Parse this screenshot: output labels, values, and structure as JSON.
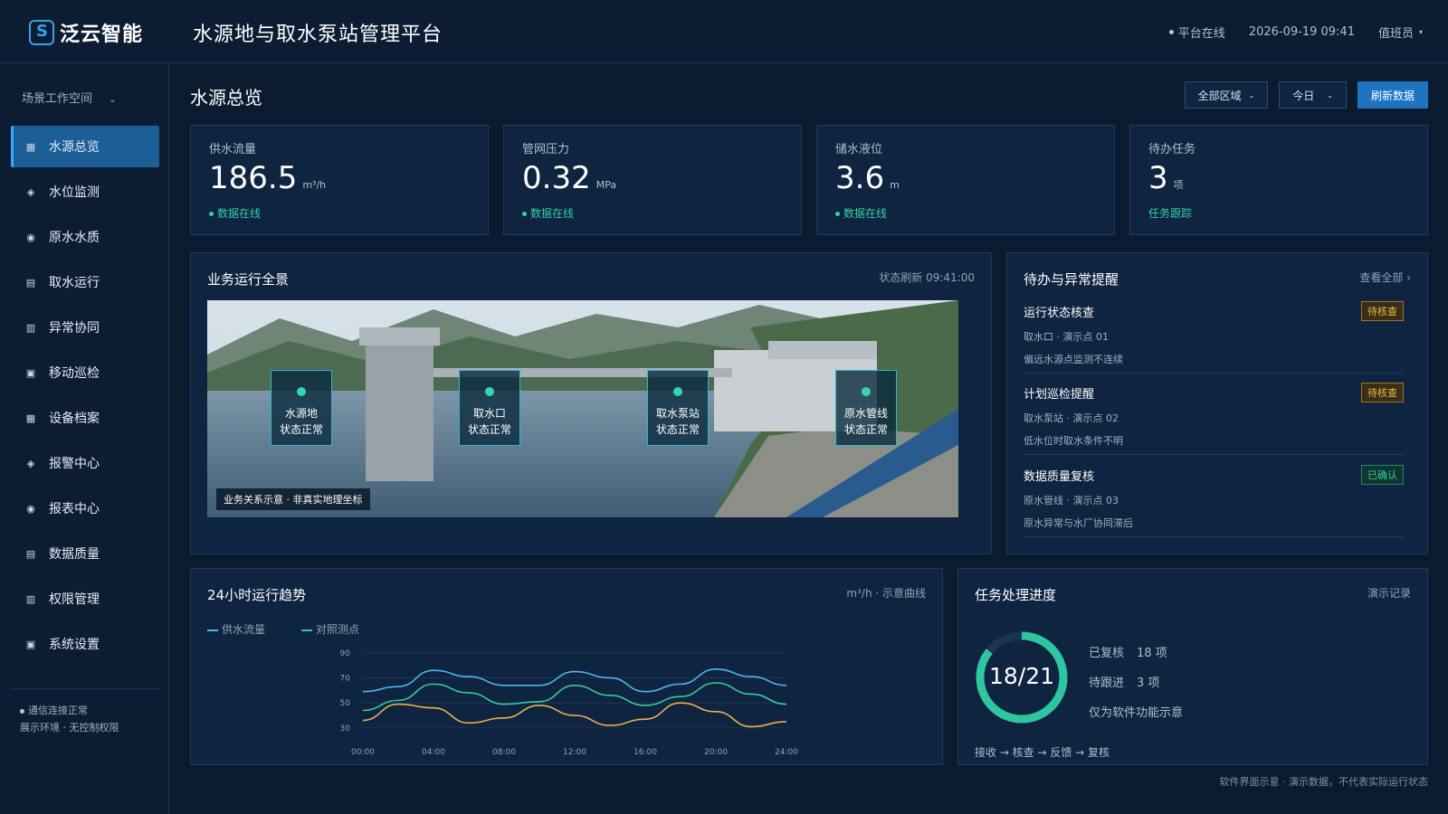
{
  "header": {
    "logo_text": "泛云智能",
    "app_title": "水源地与取水泵站管理平台",
    "status": "平台在线",
    "datetime": "2026-09-19 09:41",
    "user": "值班员"
  },
  "sidebar": {
    "workspace": "场景工作空间",
    "items": [
      {
        "label": "水源总览",
        "icon": "grid-icon",
        "active": true
      },
      {
        "label": "水位监测",
        "icon": "diamond-icon"
      },
      {
        "label": "原水水质",
        "icon": "circle-dot-icon"
      },
      {
        "label": "取水运行",
        "icon": "list-icon"
      },
      {
        "label": "异常协同",
        "icon": "columns-icon"
      },
      {
        "label": "移动巡检",
        "icon": "square-icon"
      },
      {
        "label": "设备档案",
        "icon": "grid-icon"
      },
      {
        "label": "报警中心",
        "icon": "diamond-icon"
      },
      {
        "label": "报表中心",
        "icon": "circle-dot-icon"
      },
      {
        "label": "数据质量",
        "icon": "list-icon"
      },
      {
        "label": "权限管理",
        "icon": "columns-icon"
      },
      {
        "label": "系统设置",
        "icon": "square-icon"
      }
    ],
    "footer_status": "通信连接正常",
    "footer_note": "展示环境 · 无控制权限"
  },
  "main": {
    "title": "水源总览",
    "filters": {
      "region": "全部区域",
      "period": "今日",
      "refresh": "刷新数据"
    }
  },
  "kpis": [
    {
      "label": "供水流量",
      "value": "186.5",
      "unit": "m³/h",
      "status": "数据在线",
      "status_dot": true
    },
    {
      "label": "管网压力",
      "value": "0.32",
      "unit": "MPa",
      "status": "数据在线",
      "status_dot": true
    },
    {
      "label": "储水液位",
      "value": "3.6",
      "unit": "m",
      "status": "数据在线",
      "status_dot": true
    },
    {
      "label": "待办任务",
      "value": "3",
      "unit": "项",
      "status": "任务跟踪",
      "status_dot": false
    }
  ],
  "overview": {
    "title": "业务运行全景",
    "refresh": "状态刷新 09:41:00",
    "nodes": [
      {
        "name": "水源地",
        "state": "状态正常"
      },
      {
        "name": "取水口",
        "state": "状态正常"
      },
      {
        "name": "取水泵站",
        "state": "状态正常"
      },
      {
        "name": "原水管线",
        "state": "状态正常"
      }
    ],
    "tag": "业务关系示意 · 非真实地理坐标"
  },
  "alerts": {
    "title": "待办与异常提醒",
    "view_all": "查看全部 ›",
    "items": [
      {
        "title": "运行状态核查",
        "location": "取水口 · 演示点 01",
        "desc": "偏远水源点监测不连续",
        "badge": "待核查",
        "badge_type": "pending"
      },
      {
        "title": "计划巡检提醒",
        "location": "取水泵站 · 演示点 02",
        "desc": "低水位时取水条件不明",
        "badge": "待核查",
        "badge_type": "pending"
      },
      {
        "title": "数据质量复核",
        "location": "原水管线 · 演示点 03",
        "desc": "原水异常与水厂协同滞后",
        "badge": "已确认",
        "badge_type": "done"
      }
    ]
  },
  "trend": {
    "title": "24小时运行趋势",
    "meta": "m³/h · 示意曲线",
    "legend": [
      "供水流量",
      "对照测点"
    ]
  },
  "chart_data": {
    "type": "line",
    "x": [
      "00:00",
      "02:00",
      "04:00",
      "06:00",
      "08:00",
      "10:00",
      "12:00",
      "14:00",
      "16:00",
      "18:00",
      "20:00",
      "22:00",
      "24:00"
    ],
    "xticks": [
      "00:00",
      "04:00",
      "08:00",
      "12:00",
      "16:00",
      "20:00",
      "24:00"
    ],
    "yticks": [
      90,
      70,
      50,
      30
    ],
    "ylim": [
      27,
      92
    ],
    "series": [
      {
        "name": "供水流量",
        "color": "#4fb6ee",
        "values": [
          59,
          63,
          76,
          71,
          64,
          64,
          75,
          70,
          59,
          65,
          77,
          71,
          64
        ]
      },
      {
        "name": "对照测点",
        "color": "#35c9a0",
        "values": [
          44,
          52,
          65,
          58,
          49,
          51,
          64,
          56,
          48,
          55,
          66,
          57,
          49
        ]
      },
      {
        "color": "#e6b44c",
        "values": [
          36,
          49,
          46,
          34,
          38,
          48,
          40,
          32,
          37,
          50,
          43,
          31,
          35
        ]
      }
    ]
  },
  "progress": {
    "title": "任务处理进度",
    "meta": "演示记录",
    "done": 18,
    "total": 21,
    "ring_label": "18/21",
    "stats": [
      {
        "label": "已复核",
        "value": "18 项"
      },
      {
        "label": "待跟进",
        "value": "3 项"
      }
    ],
    "note": "仅为软件功能示意",
    "flow": "接收 → 核查 → 反馈 → 复核",
    "ring_color": "#2ec6a0"
  },
  "footnote": "软件界面示意 · 演示数据，不代表实际运行状态"
}
